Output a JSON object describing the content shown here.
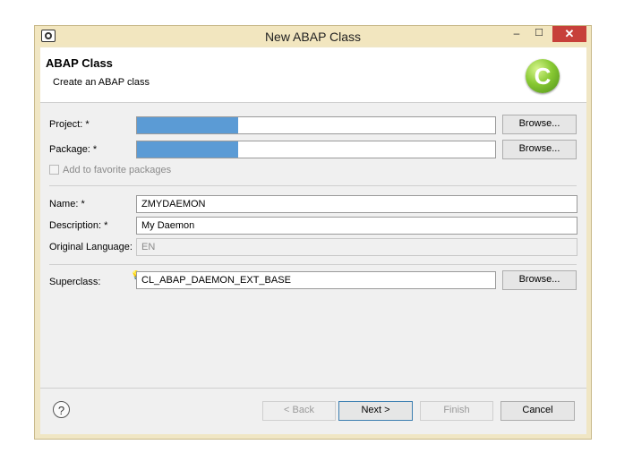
{
  "window": {
    "title": "New ABAP Class",
    "minimize_glyph": "–",
    "maximize_glyph": "☐",
    "close_glyph": "✕"
  },
  "header": {
    "title": "ABAP Class",
    "subtitle": "Create an ABAP class",
    "logo_letter": "C"
  },
  "form": {
    "project": {
      "label": "Project: *",
      "value": "",
      "browse": "Browse..."
    },
    "package": {
      "label": "Package: *",
      "value": "",
      "browse": "Browse..."
    },
    "favorite": {
      "label": "Add to favorite packages",
      "checked": false
    },
    "name": {
      "label": "Name: *",
      "value": "ZMYDAEMON"
    },
    "description": {
      "label": "Description: *",
      "value": "My Daemon"
    },
    "original_language": {
      "label": "Original Language:",
      "value": "EN"
    },
    "superclass": {
      "label": "Superclass:",
      "value": "CL_ABAP_DAEMON_EXT_BASE",
      "browse": "Browse..."
    }
  },
  "footer": {
    "help_glyph": "?",
    "back": "< Back",
    "next": "Next >",
    "finish": "Finish",
    "cancel": "Cancel"
  },
  "icons": [
    "app-icon",
    "class-logo-icon",
    "help-icon",
    "content-assist-icon"
  ],
  "colors": {
    "accent": "#5b9bd5",
    "close": "#c7403a",
    "title_bar": "#f2e6bf"
  }
}
